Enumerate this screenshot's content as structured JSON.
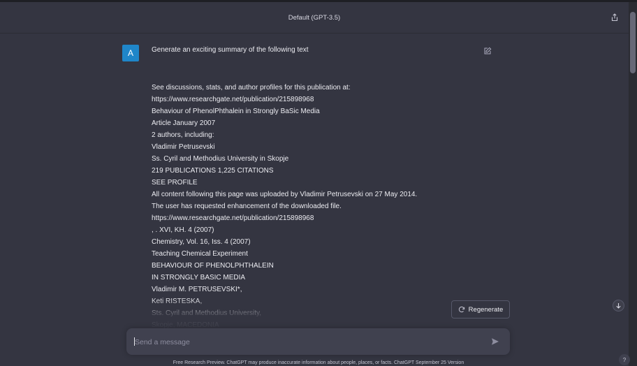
{
  "header": {
    "model_title": "Default (GPT-3.5)",
    "share_icon": "share-icon"
  },
  "user_message": {
    "avatar_initial": "A",
    "prompt_title": "Generate an exciting summary of the following text",
    "edit_icon": "edit-icon",
    "lines": [
      "See discussions, stats, and author profiles for this publication at:",
      "https://www.researchgate.net/publication/215898968",
      "Behaviour of PhenolPhthalein in Strongly BaSic Media",
      "Article January 2007",
      "2 authors, including:",
      "Vladimir Petrusevski",
      "Ss. Cyril and Methodius University in Skopje",
      "219 PUBLICATIONS 1,225 CITATIONS",
      "SEE PROFILE",
      "All content following this page was uploaded by Vladimir Petrusevski on 27 May 2014.",
      "The user has requested enhancement of the downloaded file.",
      "https://www.researchgate.net/publication/215898968",
      ", . XVI, KH. 4 (2007)",
      "Chemistry, Vol. 16, Iss. 4 (2007)",
      "Teaching Chemical Experiment",
      "BEHAVIOUR OF PHENOLPHTHALEIN",
      "IN STRONGLY BASIC MEDIA",
      "Vladimir M. PETRUSEVSKI*,",
      "Keti RISTESKA,",
      "Sts. Cyril and Methodius University,",
      "Skopje, MACEDONIA"
    ]
  },
  "regenerate": {
    "label": "Regenerate",
    "icon": "refresh-icon"
  },
  "composer": {
    "placeholder": "Send a message",
    "value": "",
    "send_icon": "send-icon"
  },
  "scroll_down_icon": "arrow-down-icon",
  "footer": {
    "disclaimer": "Free Research Preview. ChatGPT may produce inaccurate information about people, places, or facts. ChatGPT September 25 Version"
  },
  "help": {
    "label": "?"
  },
  "colors": {
    "background": "#343541",
    "input_background": "#40414f",
    "avatar": "#1f86c9",
    "text": "#ececf1"
  }
}
